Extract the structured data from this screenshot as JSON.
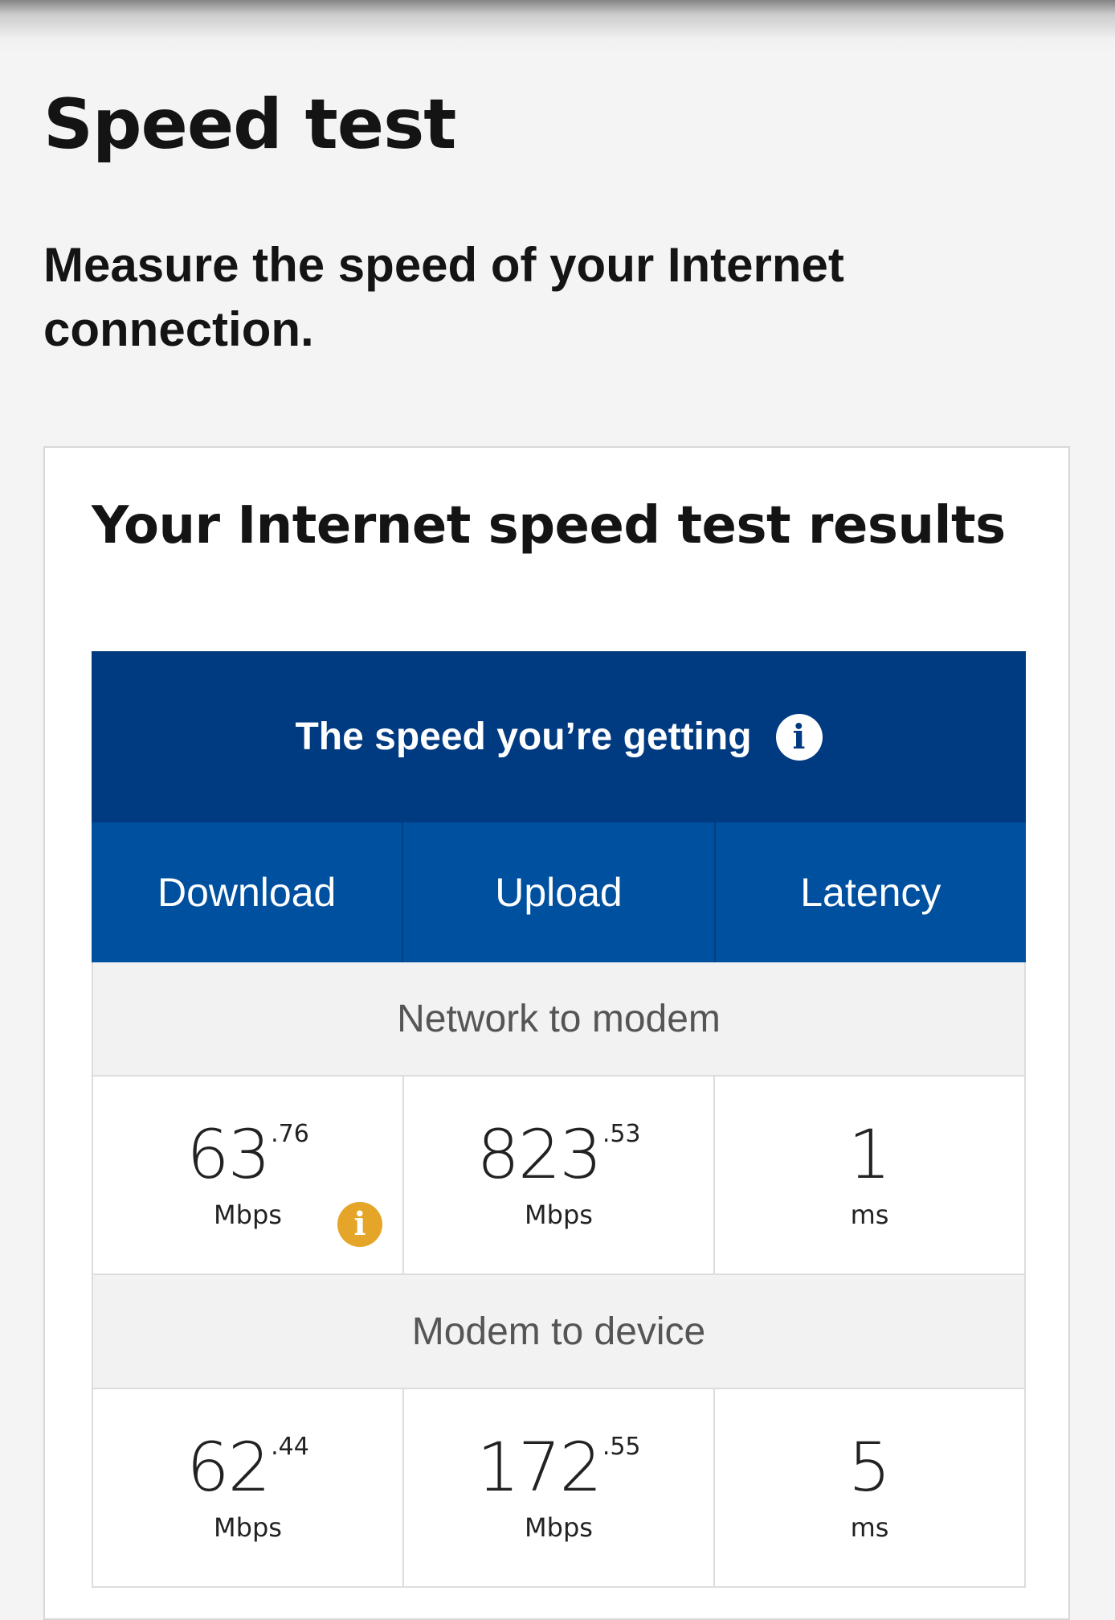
{
  "page": {
    "title": "Speed test",
    "subtitle": "Measure the speed of your Internet connection."
  },
  "card": {
    "title": "Your Internet speed test results"
  },
  "results": {
    "banner_label": "The speed you’re getting",
    "banner_icon": "info-icon",
    "columns": [
      "Download",
      "Upload",
      "Latency"
    ],
    "sections": [
      {
        "label": "Network to modem",
        "download": {
          "int": "63",
          "dec": ".76",
          "unit": "Mbps",
          "warning_icon": "info-icon"
        },
        "upload": {
          "int": "823",
          "dec": ".53",
          "unit": "Mbps"
        },
        "latency": {
          "int": "1",
          "dec": "",
          "unit": "ms"
        }
      },
      {
        "label": "Modem to device",
        "download": {
          "int": "62",
          "dec": ".44",
          "unit": "Mbps"
        },
        "upload": {
          "int": "172",
          "dec": ".55",
          "unit": "Mbps"
        },
        "latency": {
          "int": "5",
          "dec": "",
          "unit": "ms"
        }
      }
    ]
  },
  "colors": {
    "banner": "#003a80",
    "header_row": "#0050a0",
    "warning": "#e4a528",
    "background": "#f4f4f4"
  }
}
